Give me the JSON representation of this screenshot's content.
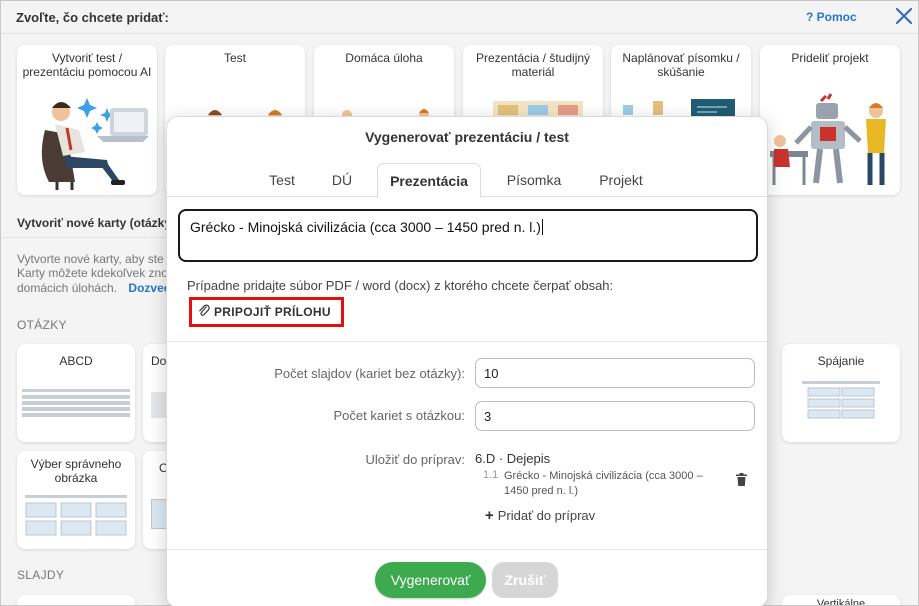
{
  "header": {
    "title": "Zvoľte, čo chcete pridať:",
    "help_label": "? Pomoc"
  },
  "top_cards": [
    {
      "label": "Vytvoriť test / prezentáciu pomocou AI"
    },
    {
      "label": "Test"
    },
    {
      "label": "Domáca úloha"
    },
    {
      "label": "Prezentácia / študijný materiál"
    },
    {
      "label": "Naplánovať písomku / skúšanie"
    },
    {
      "label": "Prideliť projekt"
    }
  ],
  "sections": {
    "new_cards_title": "Vytvoriť nové karty (otázky",
    "new_cards_desc_1": "Vytvorte nové karty, aby ste",
    "new_cards_desc_2": "Karty môžete kdekoľvek zno",
    "new_cards_desc_3": "domácich úlohách.",
    "new_cards_link": "Dozvedi",
    "questions": "OTÁZKY",
    "slides": "SLAJDY"
  },
  "question_cards": [
    {
      "label": "ABCD"
    },
    {
      "label": "Do"
    },
    {
      "label": "Spájanie"
    },
    {
      "label": "Výber správneho obrázka"
    },
    {
      "label": "O"
    }
  ],
  "bottom_peek": "Vertikálne",
  "modal": {
    "title": "Vygenerovať prezentáciu / test",
    "tabs": [
      "Test",
      "DÚ",
      "Prezentácia",
      "Písomka",
      "Projekt"
    ],
    "active_tab": "Prezentácia",
    "topic_value": "Grécko - Minojská civilizácia (cca 3000 – 1450 pred n. l.)",
    "hint": "Prípadne pridajte súbor PDF / word (docx) z ktorého chcete čerpať obsah:",
    "attach_label": "PRIPOJIŤ PRÍLOHU",
    "fields": {
      "slides_label": "Počet slajdov (kariet bez otázky):",
      "slides_value": "10",
      "questions_label": "Počet kariet s otázkou:",
      "questions_value": "3",
      "save_label": "Uložiť do príprav:",
      "save_value": "6.D · Dejepis",
      "save_item_number": "1.1",
      "save_item_text": "Grécko - Minojská civilizácia (cca 3000 – 1450 pred n. l.)",
      "add_prep_label": "Pridať do príprav"
    },
    "generate_label": "Vygenerovať",
    "cancel_label": "Zrušiť"
  },
  "colors": {
    "accent_blue": "#2a74c9",
    "generate_green": "#3daa4f",
    "highlight_red": "#e31010"
  }
}
